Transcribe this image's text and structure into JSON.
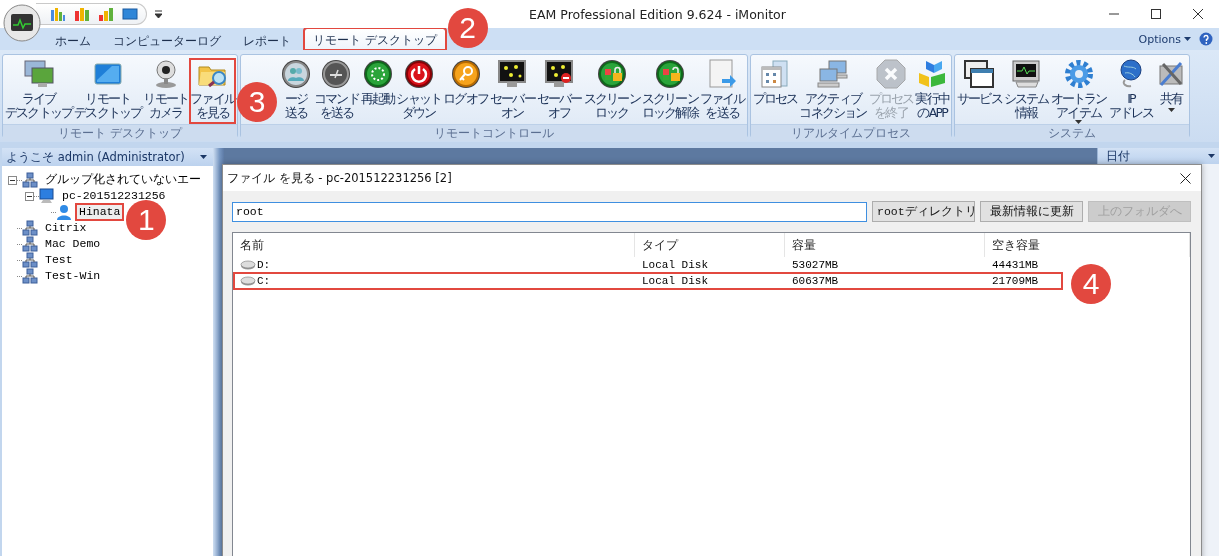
{
  "window": {
    "title": "EAM Professional Edition 9.624 - iMonitor"
  },
  "tabs": [
    {
      "label": "ホーム",
      "selected": false,
      "highlighted": false
    },
    {
      "label": "コンピューターログ",
      "selected": false,
      "highlighted": false
    },
    {
      "label": "レポート",
      "selected": false,
      "highlighted": false
    },
    {
      "label": "リモート デスクトップ",
      "selected": true,
      "highlighted": true
    }
  ],
  "options_label": "Options",
  "ribbon": {
    "groups": [
      {
        "title": "リモート デスクトップ",
        "buttons": [
          {
            "lines": [
              "ライブ",
              "デスクトップ"
            ],
            "disabled": false,
            "highlighted": false,
            "kind": "plain"
          },
          {
            "lines": [
              "リモート",
              "デスクトップ"
            ],
            "disabled": false,
            "highlighted": false,
            "kind": "plain"
          },
          {
            "lines": [
              "リモート",
              "カメラ"
            ],
            "disabled": false,
            "highlighted": false,
            "kind": "plain"
          },
          {
            "lines": [
              "ファイル",
              "を見る"
            ],
            "disabled": false,
            "highlighted": true,
            "kind": "plain"
          }
        ]
      },
      {
        "title": "リモートコントロール",
        "buttons": [
          {
            "lines": [
              "ージ",
              "送る"
            ],
            "disabled": false,
            "highlighted": false,
            "kind": "plain"
          },
          {
            "lines": [
              "コマンド",
              "を送る"
            ],
            "disabled": false,
            "highlighted": false,
            "kind": "plain"
          },
          {
            "lines": [
              "再起動"
            ],
            "disabled": false,
            "highlighted": false,
            "kind": "plain"
          },
          {
            "lines": [
              "シャット",
              "ダウン"
            ],
            "disabled": false,
            "highlighted": false,
            "kind": "plain"
          },
          {
            "lines": [
              "ログオフ"
            ],
            "disabled": false,
            "highlighted": false,
            "kind": "plain"
          },
          {
            "lines": [
              "セーバー",
              "オン"
            ],
            "disabled": false,
            "highlighted": false,
            "kind": "plain"
          },
          {
            "lines": [
              "セーバー",
              "オフ"
            ],
            "disabled": false,
            "highlighted": false,
            "kind": "plain"
          },
          {
            "lines": [
              "スクリーン",
              "ロック"
            ],
            "disabled": false,
            "highlighted": false,
            "kind": "plain"
          },
          {
            "lines": [
              "スクリーン",
              "ロック解除"
            ],
            "disabled": false,
            "highlighted": false,
            "kind": "plain"
          },
          {
            "lines": [
              "ファイル",
              "を送る"
            ],
            "disabled": false,
            "highlighted": false,
            "kind": "plain"
          }
        ]
      },
      {
        "title": "リアルタイムプロセス",
        "buttons": [
          {
            "lines": [
              "プロセス"
            ],
            "disabled": false,
            "highlighted": false,
            "kind": "plain"
          },
          {
            "lines": [
              "アクティブ",
              "コネクション"
            ],
            "disabled": false,
            "highlighted": false,
            "kind": "plain"
          },
          {
            "lines": [
              "プロセス",
              "を終了"
            ],
            "disabled": true,
            "highlighted": false,
            "kind": "plain"
          },
          {
            "lines": [
              "実行中",
              "のAPP"
            ],
            "disabled": false,
            "highlighted": false,
            "kind": "plain"
          }
        ]
      },
      {
        "title": "システム",
        "buttons": [
          {
            "lines": [
              "サービス"
            ],
            "disabled": false,
            "highlighted": false,
            "kind": "plain"
          },
          {
            "lines": [
              "システム",
              "情報"
            ],
            "disabled": false,
            "highlighted": false,
            "kind": "plain"
          },
          {
            "lines": [
              "オートラン",
              "アイテム"
            ],
            "disabled": false,
            "highlighted": false,
            "kind": "menu_inline"
          },
          {
            "lines": [
              "IP",
              "アドレス"
            ],
            "disabled": false,
            "highlighted": false,
            "kind": "plain"
          },
          {
            "lines": [
              "共有"
            ],
            "disabled": false,
            "highlighted": false,
            "kind": "menu_below"
          }
        ]
      }
    ]
  },
  "sidebar": {
    "header": "ようこそ admin (Administrator)",
    "tree": [
      {
        "label": "グルップ化されていないエー",
        "kind": "group",
        "expanded": true,
        "highlighted": false,
        "children": [
          {
            "label": "pc-201512231256",
            "kind": "computer",
            "expanded": true,
            "highlighted": false,
            "children": [
              {
                "label": "Hinata",
                "kind": "user",
                "highlighted": true
              }
            ]
          }
        ]
      },
      {
        "label": "Citrix",
        "kind": "group",
        "highlighted": false
      },
      {
        "label": "Mac Demo",
        "kind": "group",
        "highlighted": false
      },
      {
        "label": "Test",
        "kind": "group",
        "highlighted": false
      },
      {
        "label": "Test-Win",
        "kind": "group",
        "highlighted": false
      }
    ]
  },
  "right_panel": {
    "header": "日付"
  },
  "dialog": {
    "title": "ファイル を見る - pc-201512231256 [2]",
    "path": "root",
    "buttons": [
      {
        "label": "rootディレクトリ",
        "disabled": false
      },
      {
        "label": "最新情報に更新",
        "disabled": false
      },
      {
        "label": "上のフォルダへ",
        "disabled": true
      }
    ],
    "columns": [
      "名前",
      "タイプ",
      "容量",
      "空き容量"
    ],
    "rows": [
      {
        "cells": [
          "D:",
          "Local Disk",
          "53027MB",
          "44431MB"
        ],
        "highlighted": false
      },
      {
        "cells": [
          "C:",
          "Local Disk",
          "60637MB",
          "21709MB"
        ],
        "highlighted": true
      }
    ]
  },
  "callouts": [
    {
      "number": "1"
    },
    {
      "number": "2"
    },
    {
      "number": "3"
    },
    {
      "number": "4"
    }
  ]
}
